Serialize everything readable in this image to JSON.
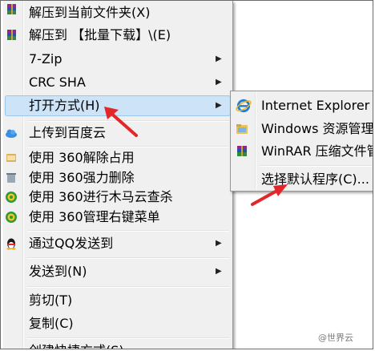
{
  "menu": {
    "items": [
      {
        "label": "解压到当前文件夹(X)",
        "icon": "winrar-icon"
      },
      {
        "label": "解压到 【批量下载】\\(E)",
        "icon": "winrar-icon"
      },
      {
        "label": "7-Zip",
        "submenu": true
      },
      {
        "label": "CRC SHA",
        "submenu": true
      },
      {
        "label": "打开方式(H)",
        "submenu": true,
        "highlighted": true
      },
      {
        "label": "上传到百度云",
        "icon": "baidu-cloud-icon"
      },
      {
        "label": "使用 360解除占用",
        "icon": "360-unlock-icon"
      },
      {
        "label": "使用 360强力删除",
        "icon": "360-delete-icon"
      },
      {
        "label": "使用 360进行木马云查杀",
        "icon": "360-scan-icon"
      },
      {
        "label": "使用 360管理右键菜单",
        "icon": "360-manage-icon"
      },
      {
        "label": "通过QQ发送到",
        "icon": "qq-icon",
        "submenu": true
      },
      {
        "label": "发送到(N)",
        "submenu": true
      },
      {
        "label": "剪切(T)"
      },
      {
        "label": "复制(C)"
      },
      {
        "label": "创建快捷方式(S)"
      }
    ]
  },
  "submenu": {
    "items": [
      {
        "label": "Internet Explorer",
        "icon": "internet-explorer-icon"
      },
      {
        "label": "Windows 资源管理器",
        "icon": "windows-explorer-icon"
      },
      {
        "label": "WinRAR 压缩文件管理器",
        "icon": "winrar-icon"
      },
      {
        "label": "选择默认程序(C)..."
      }
    ]
  },
  "watermark": "@世界云",
  "colors": {
    "highlight": "#cde4f8",
    "highlight_border": "#9bc6ee",
    "arrow": "#e3262a",
    "menu_bg": "#f0f0f0"
  }
}
